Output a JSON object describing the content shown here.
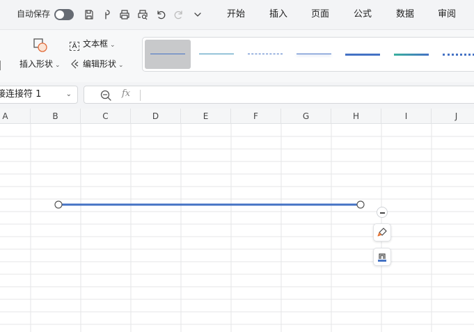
{
  "titlebar": {
    "autosave_label": "自动保存",
    "autosave_on": false,
    "menu": [
      "开始",
      "插入",
      "页面",
      "公式",
      "数据",
      "审阅"
    ]
  },
  "ribbon": {
    "insert_shape_label": "插入形状",
    "textbox_label": "文本框",
    "edit_shape_label": "编辑形状",
    "selected_style_index": 0
  },
  "formula_bar": {
    "name_box_value": "接连接符 1",
    "fx_label": "fx",
    "formula_value": ""
  },
  "sheet": {
    "columns": [
      "A",
      "B",
      "C",
      "D",
      "E",
      "F",
      "G",
      "H",
      "I",
      "J"
    ]
  },
  "colors": {
    "accent_line": "#4472c4",
    "teal_line": "#3ab09e",
    "chrome_bg": "#f3f4f6"
  },
  "icons": {
    "save": "save-icon",
    "format_painter": "format-painter-icon",
    "print": "print-icon",
    "print_preview": "print-preview-icon",
    "undo": "undo-icon",
    "redo": "redo-icon",
    "more": "chevron-down-icon"
  }
}
